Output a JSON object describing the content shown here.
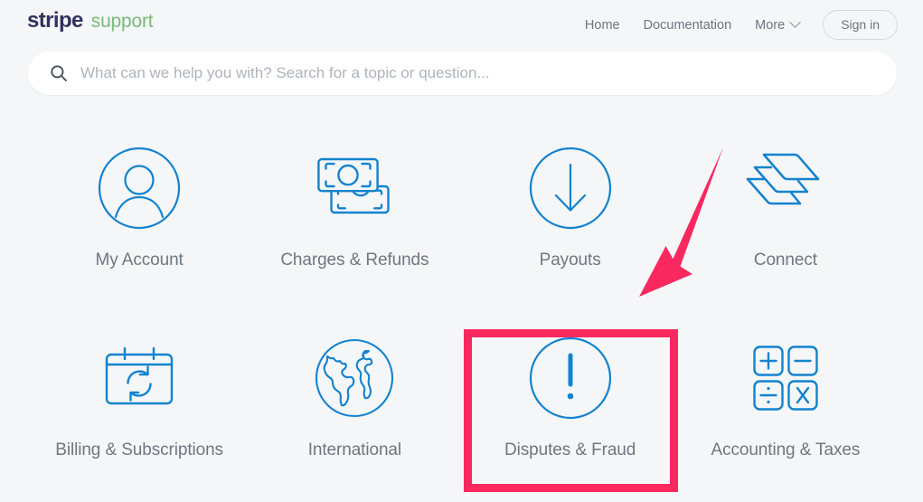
{
  "header": {
    "brand_primary": "stripe",
    "brand_secondary": "support",
    "nav": [
      {
        "label": "Home",
        "name": "nav-home"
      },
      {
        "label": "Documentation",
        "name": "nav-documentation"
      },
      {
        "label": "More",
        "name": "nav-more"
      }
    ],
    "sign_in_label": "Sign in"
  },
  "search": {
    "placeholder": "What can we help you with? Search for a topic or question...",
    "value": "",
    "icon": "search-icon"
  },
  "categories": [
    {
      "label": "My Account",
      "icon": "person-circle-icon"
    },
    {
      "label": "Charges & Refunds",
      "icon": "banknotes-icon"
    },
    {
      "label": "Payouts",
      "icon": "arrow-down-circle-icon"
    },
    {
      "label": "Connect",
      "icon": "stacked-layers-icon"
    },
    {
      "label": "Billing & Subscriptions",
      "icon": "calendar-refresh-icon"
    },
    {
      "label": "International",
      "icon": "globe-icon"
    },
    {
      "label": "Disputes & Fraud",
      "icon": "exclamation-circle-icon"
    },
    {
      "label": "Accounting & Taxes",
      "icon": "calculator-operators-icon"
    }
  ],
  "annotations": {
    "highlighted_category": "Disputes & Fraud",
    "highlight_color": "#f9295f",
    "arrow_color": "#f9295f",
    "arrow_direction": "down-left"
  },
  "colors": {
    "background": "#f5f6f8",
    "icon_blue": "#1283ce",
    "brand_navy": "#32325d",
    "brand_green": "#79b97a",
    "label_gray": "#6e7781"
  }
}
